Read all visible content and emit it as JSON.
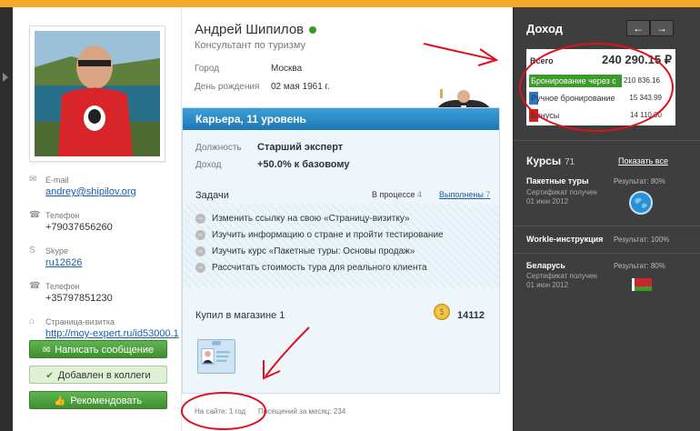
{
  "profile": {
    "name": "Андрей Шипилов",
    "role": "Консультант по туризму",
    "city_label": "Город",
    "city": "Москва",
    "birthday_label": "День рождения",
    "birthday": "02 мая 1961 г."
  },
  "contacts": [
    {
      "label": "E-mail",
      "value": "andrey@shipilov.org",
      "icon": "envelope-icon"
    },
    {
      "label": "Телефон",
      "value": "+79037656260",
      "icon": "phone-icon"
    },
    {
      "label": "Skype",
      "value": "ru12626",
      "icon": "skype-icon"
    },
    {
      "label": "Телефон",
      "value": "+35797851230",
      "icon": "phone-icon"
    },
    {
      "label": "Страница-визитка",
      "value": "http://moy-expert.ru/id53000.1",
      "icon": "link-icon"
    }
  ],
  "buttons": {
    "message": "Написать сообщение",
    "colleagues": "Добавлен в коллеги",
    "recommend": "Рекомендовать"
  },
  "career": {
    "title": "Карьера, 11 уровень",
    "position_label": "Должность",
    "position": "Старший эксперт",
    "income_label": "Доход",
    "income": "+50.0% к базовому",
    "tasks_label": "Задачи",
    "tab_progress": "В процессе",
    "tab_progress_count": "4",
    "tab_done": "Выполнены",
    "tab_done_count": "7",
    "tasks": [
      "Изменить ссылку на свою «Страницу-визитку»",
      "Изучить информацию о стране и пройти тестирование",
      "Изучить курс «Пакетные туры: Основы продаж»",
      "Рассчитать стоимость тура для реального клиента"
    ],
    "shop_label": "Купил в магазине 1",
    "coins": "14112"
  },
  "footer": {
    "onsite": "На сайте: 1 год",
    "visits": "Посещений за месяц: 234"
  },
  "income": {
    "title": "Доход",
    "prev": "←",
    "next": "→",
    "total_label": "Всего",
    "total": "240 290.15 ₽",
    "rows": [
      {
        "label": "Бронирование через с",
        "value": "210 836.16",
        "color": "#3c9b2c",
        "fraction": 0.877
      },
      {
        "label": "Ручное бронирование",
        "value": "15 343.99",
        "color": "#2a7bc6",
        "fraction": 0.064
      },
      {
        "label": "Бонусы",
        "value": "14 110.00",
        "color": "#c8262a",
        "fraction": 0.059
      }
    ]
  },
  "courses": {
    "title": "Курсы",
    "count": "71",
    "show_all": "Показать все",
    "items": [
      {
        "name": "Пакетные туры",
        "result": "Результат: 80%",
        "sub1": "Сертификат получен",
        "sub2": "01 июн 2012",
        "icon": "globe-icon"
      },
      {
        "name": "Workle-инструкция",
        "result": "Результат: 100%"
      },
      {
        "name": "Беларусь",
        "result": "Результат: 80%",
        "sub1": "Сертификат получен",
        "sub2": "01 июн 2012",
        "icon": "belarus-flag-icon"
      }
    ]
  }
}
